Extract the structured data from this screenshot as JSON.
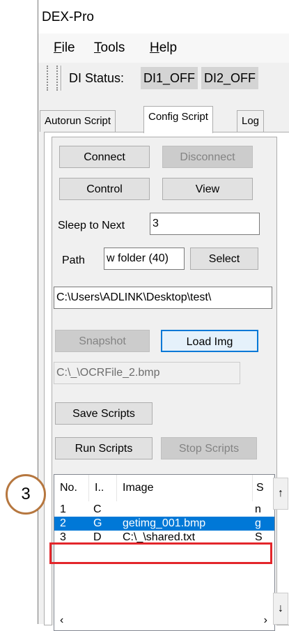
{
  "window": {
    "title": "DEX-Pro"
  },
  "menu": {
    "file": "File",
    "tools": "Tools",
    "help": "Help"
  },
  "toolbar": {
    "di_label": "DI Status:",
    "di1": "DI1_OFF",
    "di2": "DI2_OFF"
  },
  "tabs": [
    "Autorun Script",
    "Config Script",
    "Log"
  ],
  "config": {
    "connect": "Connect",
    "disconnect": "Disconnect",
    "control": "Control",
    "view": "View",
    "sleep_label": "Sleep to Next",
    "sleep_value": "3",
    "path_label": "Path",
    "path_value": "w folder (40)",
    "select": "Select",
    "folder_value": "C:\\Users\\ADLINK\\Desktop\\test\\",
    "snapshot": "Snapshot",
    "load_img": "Load Img",
    "img_path": "C:\\_\\OCRFile_2.bmp",
    "save_scripts": "Save Scripts",
    "run_scripts": "Run Scripts",
    "stop_scripts": "Stop Scripts"
  },
  "list": {
    "headers": {
      "no": "No.",
      "i": "I..",
      "image": "Image",
      "s": "S"
    },
    "rows": [
      {
        "no": "1",
        "i": "C",
        "image": "",
        "s": "n"
      },
      {
        "no": "2",
        "i": "G",
        "image": "getimg_001.bmp",
        "s": "g"
      },
      {
        "no": "3",
        "i": "D",
        "image": "C:\\_\\shared.txt",
        "s": "S"
      }
    ],
    "selected_row": 2
  },
  "annotation": {
    "callout_number": "3"
  },
  "colors": {
    "selection": "#0078d7",
    "highlight": "#e3262b",
    "callout_border": "#b6773f"
  }
}
